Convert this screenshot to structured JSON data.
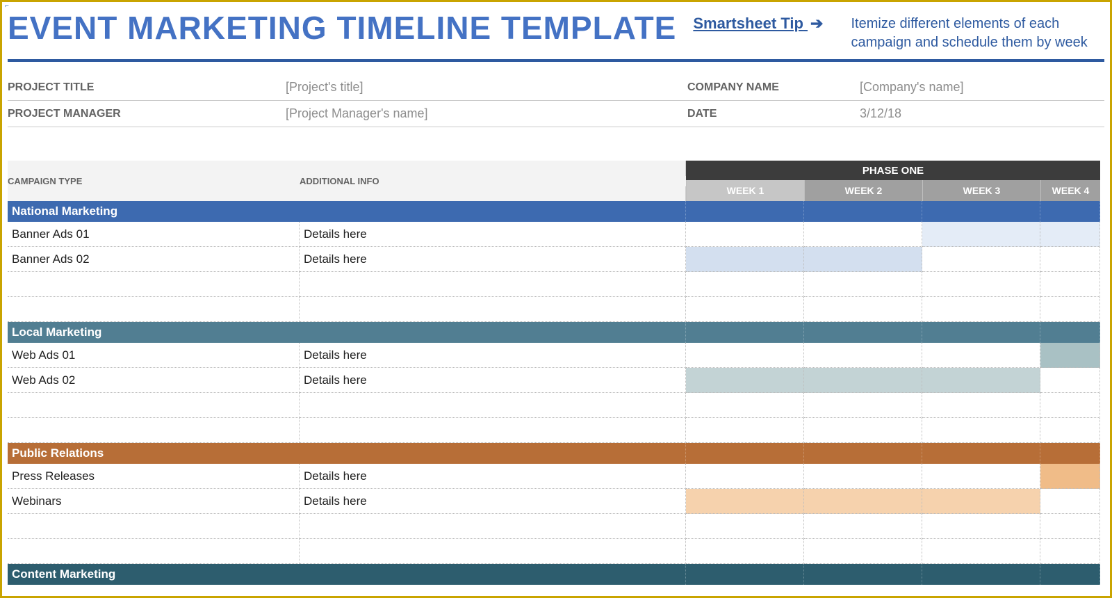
{
  "header": {
    "title": "EVENT MARKETING TIMELINE TEMPLATE",
    "tip_label": "Smartsheet Tip",
    "tip_arrow": "➔",
    "tip_text": "Itemize different elements of each campaign and schedule them by week"
  },
  "meta": {
    "project_title_label": "PROJECT TITLE",
    "project_title_value": "[Project's title]",
    "project_manager_label": "PROJECT MANAGER",
    "project_manager_value": "[Project Manager's name]",
    "company_name_label": "COMPANY NAME",
    "company_name_value": "[Company's name]",
    "date_label": "DATE",
    "date_value": "3/12/18"
  },
  "columns": {
    "campaign_type": "CAMPAIGN TYPE",
    "additional_info": "ADDITIONAL INFO",
    "phase_label": "PHASE ONE",
    "weeks": [
      "WEEK 1",
      "WEEK 2",
      "WEEK 3",
      "WEEK 4"
    ]
  },
  "sections": [
    {
      "name": "National Marketing",
      "color": "nat",
      "rows": [
        {
          "campaign": "Banner Ads 01",
          "info": "Details here",
          "cells": [
            "",
            "",
            "hl-blue-lt",
            "hl-blue-lt"
          ]
        },
        {
          "campaign": "Banner Ads 02",
          "info": "Details here",
          "cells": [
            "hl-blue-md",
            "hl-blue-md",
            "",
            ""
          ]
        },
        {
          "campaign": "",
          "info": "",
          "cells": [
            "",
            "",
            "",
            ""
          ]
        },
        {
          "campaign": "",
          "info": "",
          "cells": [
            "",
            "",
            "",
            ""
          ]
        }
      ]
    },
    {
      "name": "Local Marketing",
      "color": "loc",
      "rows": [
        {
          "campaign": "Web Ads 01",
          "info": "Details here",
          "cells": [
            "",
            "",
            "",
            "hl-teal-md"
          ]
        },
        {
          "campaign": "Web Ads 02",
          "info": "Details here",
          "cells": [
            "hl-teal-lt",
            "hl-teal-lt",
            "hl-teal-lt",
            ""
          ]
        },
        {
          "campaign": "",
          "info": "",
          "cells": [
            "",
            "",
            "",
            ""
          ]
        },
        {
          "campaign": "",
          "info": "",
          "cells": [
            "",
            "",
            "",
            ""
          ]
        }
      ]
    },
    {
      "name": "Public Relations",
      "color": "pr",
      "rows": [
        {
          "campaign": "Press Releases",
          "info": "Details here",
          "cells": [
            "",
            "",
            "",
            "hl-org-md"
          ]
        },
        {
          "campaign": "Webinars",
          "info": "Details here",
          "cells": [
            "hl-org-lt",
            "hl-org-lt",
            "hl-org-lt",
            ""
          ]
        },
        {
          "campaign": "",
          "info": "",
          "cells": [
            "",
            "",
            "",
            ""
          ]
        },
        {
          "campaign": "",
          "info": "",
          "cells": [
            "",
            "",
            "",
            ""
          ]
        }
      ]
    },
    {
      "name": "Content Marketing",
      "color": "cm",
      "rows": []
    }
  ]
}
